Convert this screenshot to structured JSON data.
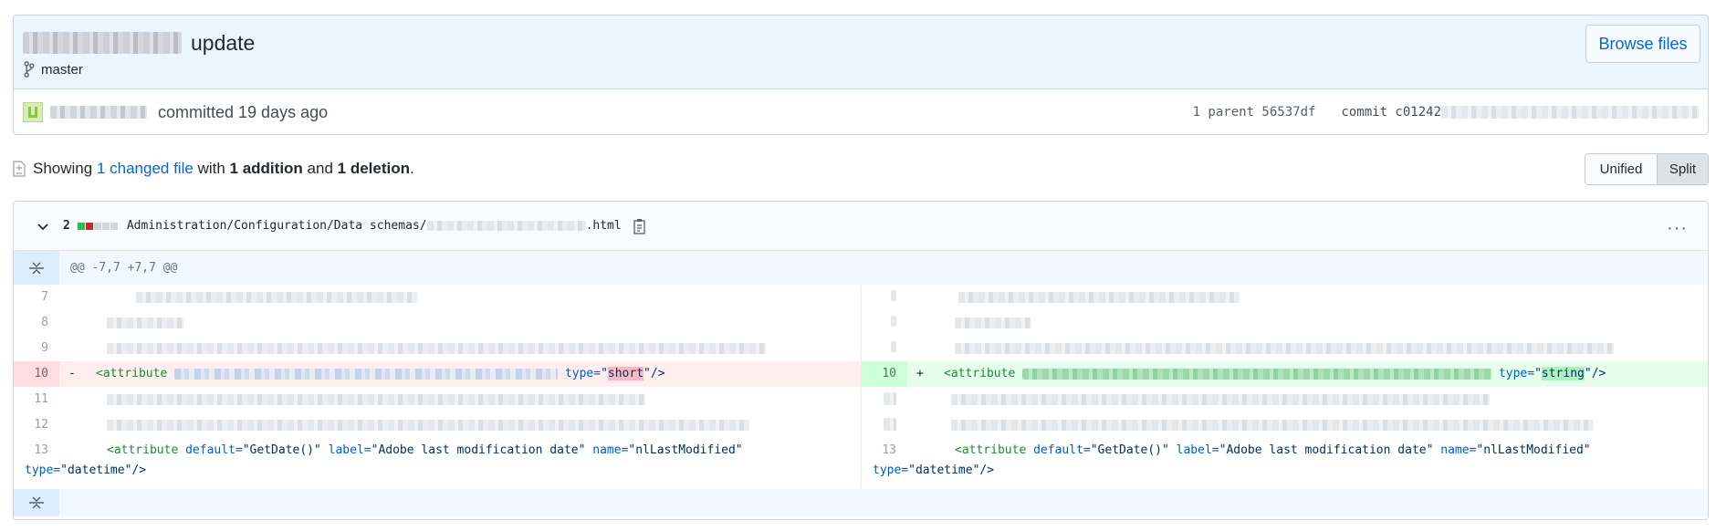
{
  "commit": {
    "title": "update",
    "branch": "master",
    "browse_label": "Browse files",
    "committed_text": "committed 19 days ago",
    "parent_text": "1 parent 56537df",
    "commit_label": "commit c01242"
  },
  "summary": {
    "showing": "Showing",
    "changed_files": "1 changed file",
    "with": "with",
    "additions": "1 addition",
    "and": "and",
    "deletions": "1 deletion",
    "period": "."
  },
  "view_toggle": {
    "unified": "Unified",
    "split": "Split"
  },
  "file": {
    "change_count": "2",
    "path": "Administration/Configuration/Data schemas/",
    "path_suffix": ".html",
    "more": "···"
  },
  "hunk_header": "@@ -7,7 +7,7 @@",
  "diff": {
    "left_lines": [
      "7",
      "8",
      "9",
      "10",
      "11",
      "12",
      "13"
    ],
    "right_lines": [
      "10",
      "13"
    ],
    "minus": "-",
    "plus": "+",
    "tag_open": "<attribute",
    "type_attr": "type=",
    "quote": "\"",
    "old_type": "short",
    "new_type": "string",
    "close": "\"/>",
    "l13_default_attr": "default=",
    "l13_default_val": "\"GetDate()\"",
    "l13_label_attr": "label=",
    "l13_label_val": "\"Adobe last modification date\"",
    "l13_name_attr": "name=",
    "l13_name_val": "\"nlLastModified\"",
    "l13_type_val": "\"datetime\"/>"
  },
  "colors": {
    "link": "#0366d6",
    "deletion_bg": "#ffeef0",
    "addition_bg": "#e6ffed",
    "hunk_bg": "#f1f8ff"
  }
}
